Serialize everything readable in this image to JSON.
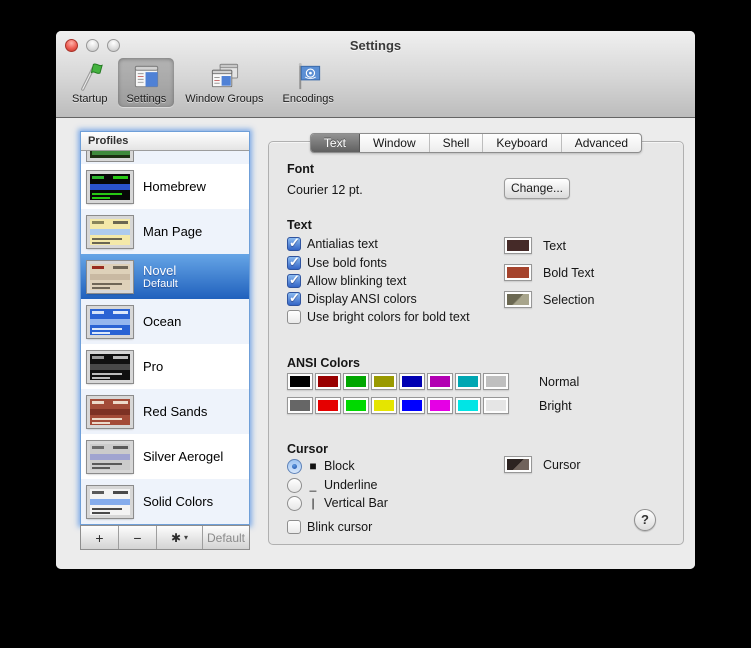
{
  "window": {
    "title": "Settings"
  },
  "icons": {
    "check": "✓",
    "gear": "✱",
    "caret_down": "▾",
    "plus": "+",
    "minus": "−",
    "help": "?"
  },
  "toolbar": {
    "items": [
      {
        "label": "Startup",
        "icon": "startup-flag-icon",
        "selected": false
      },
      {
        "label": "Settings",
        "icon": "settings-window-icon",
        "selected": true
      },
      {
        "label": "Window Groups",
        "icon": "window-groups-icon",
        "selected": false
      },
      {
        "label": "Encodings",
        "icon": "encodings-flag-icon",
        "selected": false
      }
    ]
  },
  "tabs": {
    "items": [
      {
        "label": "Text",
        "selected": true
      },
      {
        "label": "Window",
        "selected": false
      },
      {
        "label": "Shell",
        "selected": false
      },
      {
        "label": "Keyboard",
        "selected": false
      },
      {
        "label": "Advanced",
        "selected": false
      }
    ]
  },
  "profiles": {
    "header": "Profiles",
    "items": [
      {
        "name": "",
        "partial": true,
        "selected": false,
        "thumb": {
          "bg": "#1d2f12",
          "chip": "#3f8a3c",
          "band": "#3f8a3c",
          "lines": "#3f8a3c"
        }
      },
      {
        "name": "Homebrew",
        "selected": false,
        "thumb": {
          "bg": "#070707",
          "chip": "#2db52d",
          "band": "#2a52cc",
          "lines": "#28c814"
        }
      },
      {
        "name": "Man Page",
        "selected": false,
        "thumb": {
          "bg": "#f4e9a9",
          "chip": "#8a855a",
          "band": "#aecbee",
          "lines": "#6b6752"
        }
      },
      {
        "name": "Novel",
        "subtitle": "Default",
        "selected": true,
        "thumb": {
          "bg": "#ded1b9",
          "chip": "#992c1e",
          "band": "#c9b9a2",
          "lines": "#6f6656"
        }
      },
      {
        "name": "Ocean",
        "selected": false,
        "thumb": {
          "bg": "#2a63d4",
          "chip": "#d4e2f8",
          "band": "#94b6ee",
          "lines": "#dce8fa"
        }
      },
      {
        "name": "Pro",
        "selected": false,
        "thumb": {
          "bg": "#101010",
          "chip": "#9c9c9c",
          "band": "#484848",
          "lines": "#bdbdbd"
        }
      },
      {
        "name": "Red Sands",
        "selected": false,
        "thumb": {
          "bg": "#a34b38",
          "chip": "#ecd9c9",
          "band": "#7d3124",
          "lines": "#ecd9c9"
        }
      },
      {
        "name": "Silver Aerogel",
        "selected": false,
        "thumb": {
          "bg": "#cbcbcb",
          "chip": "#6a6a6a",
          "band": "#a0a4d0",
          "lines": "#595959"
        }
      },
      {
        "name": "Solid Colors",
        "selected": false,
        "thumb": {
          "bg": "#f3f3f3",
          "chip": "#5a5a5a",
          "band": "#85acec",
          "lines": "#4a4a4a"
        }
      }
    ],
    "footer": {
      "add": "+",
      "remove": "−",
      "gear": "✱",
      "gear_caret": "▾",
      "default": "Default"
    }
  },
  "font": {
    "heading": "Font",
    "value": "Courier 12 pt.",
    "change_button": "Change..."
  },
  "text": {
    "heading": "Text",
    "checkboxes": [
      {
        "label": "Antialias text",
        "checked": true
      },
      {
        "label": "Use bold fonts",
        "checked": true
      },
      {
        "label": "Allow blinking text",
        "checked": true
      },
      {
        "label": "Display ANSI colors",
        "checked": true
      },
      {
        "label": "Use bright colors for bold text",
        "checked": false
      }
    ],
    "wells": [
      {
        "label": "Text",
        "color": "#452a28"
      },
      {
        "label": "Bold Text",
        "color": "#a5432c"
      },
      {
        "label": "Selection",
        "color_top_left": "#6b6852",
        "color_bottom_right": "#a8a58c"
      }
    ]
  },
  "ansi": {
    "heading": "ANSI Colors",
    "rows": [
      {
        "label": "Normal",
        "colors": [
          "#000000",
          "#990000",
          "#00a600",
          "#999900",
          "#0000b2",
          "#b200b2",
          "#00a6b2",
          "#bfbfbf"
        ]
      },
      {
        "label": "Bright",
        "colors": [
          "#666666",
          "#e50000",
          "#00d900",
          "#e5e500",
          "#0000ff",
          "#e500e5",
          "#00e5e5",
          "#e5e5e5"
        ]
      }
    ]
  },
  "cursor": {
    "heading": "Cursor",
    "radios": [
      {
        "glyph": "■",
        "label": "Block",
        "selected": true
      },
      {
        "glyph": "_",
        "label": "Underline",
        "selected": false
      },
      {
        "glyph": "|",
        "label": "Vertical Bar",
        "selected": false
      }
    ],
    "blink": {
      "label": "Blink cursor",
      "checked": false
    },
    "well": {
      "label": "Cursor",
      "color_top_left": "#2c2321",
      "color_bottom_right": "#70635c"
    }
  },
  "help_button": "?"
}
